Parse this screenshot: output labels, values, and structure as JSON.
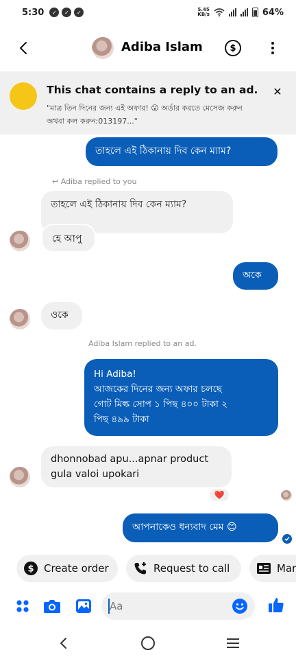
{
  "status_bar": {
    "time": "5:30",
    "speed_value": "5.45",
    "speed_unit": "KB/s",
    "battery": "64%"
  },
  "header": {
    "contact_name": "Adiba Islam"
  },
  "ad_banner": {
    "title": "This chat contains a reply to an ad.",
    "text": "\"মাত্র তিন দিনের জন্য এই অফার! 😮 অর্ডার করতে মেসেজ করুন অথবা কল করুন:013197...\""
  },
  "messages": {
    "m1": "তাহলে এই ঠিকানায় দিব কেন ম্যাম?",
    "reply_note": "Adiba replied to you",
    "m2_quote": "তাহলে এই ঠিকানায় দিব কেন ম্যাম?",
    "m2": "হে আপু",
    "m3": "অকে",
    "m4": "ওকে",
    "ad_note": "Adiba Islam replied to an ad.",
    "m5_line1": "Hi Adiba!",
    "m5_line2": "আজকের দিনের জন্য অফার চলছে",
    "m5_line3": "গোট মিল্ক সোপ ১ পিছ ৪০০ টাকা ২",
    "m5_line4": "পিছ ৪৯৯ টাকা",
    "m6": "dhonnobad apu...apnar product gula valoi upokari",
    "m6_reaction": "❤️",
    "m7": "আপনাকেও ধন্যবাদ মেম 😊"
  },
  "quick_replies": {
    "create_order": "Create order",
    "request_call": "Request to call",
    "third": "Mar"
  },
  "composer": {
    "placeholder": "Aa"
  },
  "colors": {
    "accent": "#0a5eb8",
    "bubble_in": "#f0f0f0",
    "ad_thumb": "#f5c518",
    "like": "#0866ff"
  }
}
